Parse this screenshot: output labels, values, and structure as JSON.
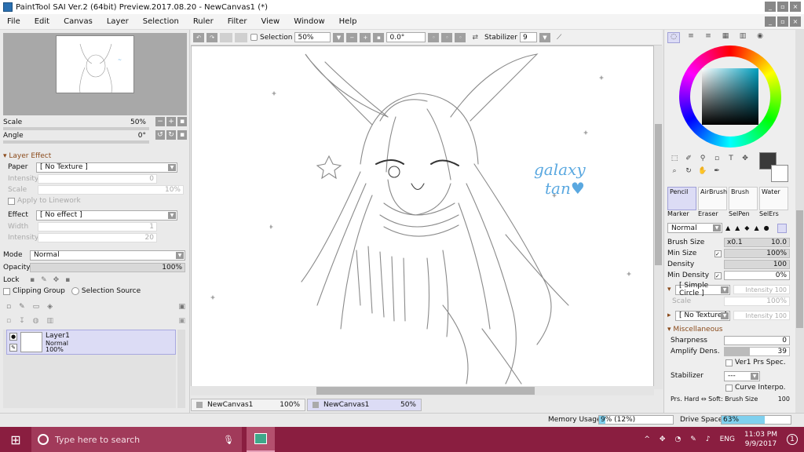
{
  "window": {
    "title": "PaintTool SAI Ver.2 (64bit) Preview.2017.08.20 - NewCanvas1 (*)"
  },
  "menu": [
    "File",
    "Edit",
    "Canvas",
    "Layer",
    "Selection",
    "Ruler",
    "Filter",
    "View",
    "Window",
    "Help"
  ],
  "navigator": {
    "scale_label": "Scale",
    "scale_value": "50%",
    "angle_label": "Angle",
    "angle_value": "0°"
  },
  "layer_effect": {
    "header": "Layer Effect",
    "paper_label": "Paper",
    "paper_value": "[ No Texture ]",
    "intensity_label": "Intensity",
    "intensity_value": "0",
    "scale_label": "Scale",
    "scale_value": "10%",
    "apply_linework": "Apply to Linework",
    "effect_label": "Effect",
    "effect_value": "[ No effect ]",
    "width_label": "Width",
    "width_value": "1",
    "effect_intensity_label": "Intensity",
    "effect_intensity_value": "20"
  },
  "layer_props": {
    "mode_label": "Mode",
    "mode_value": "Normal",
    "opacity_label": "Opacity",
    "opacity_value": "100%",
    "lock_label": "Lock",
    "clipping": "Clipping Group",
    "selection_source": "Selection Source"
  },
  "layer": {
    "name": "Layer1",
    "mode": "Normal",
    "opacity": "100%"
  },
  "toolbar": {
    "selection": "Selection",
    "zoom": "50%",
    "angle": "0.0°",
    "stabilizer_label": "Stabilizer",
    "stabilizer_value": "9"
  },
  "canvas": {
    "sketch_text_line1": "galaxy",
    "sketch_text_line2": "tan♥",
    "sketch_ink": "#5aa8e0"
  },
  "doc_tabs": [
    {
      "name": "NewCanvas1",
      "zoom": "100%"
    },
    {
      "name": "NewCanvas1",
      "zoom": "50%"
    }
  ],
  "color": {
    "current": "#3a3a3a"
  },
  "brushes": [
    "Pencil",
    "AirBrush",
    "Brush",
    "Water"
  ],
  "brushes_row2": [
    "Marker",
    "Eraser",
    "SelPen",
    "SelErs"
  ],
  "brush_settings": {
    "blend": "Normal",
    "brush_size_label": "Brush Size",
    "brush_size_mult": "x0.1",
    "brush_size_value": "10.0",
    "min_size_label": "Min Size",
    "min_size_value": "100%",
    "density_label": "Density",
    "density_value": "100",
    "min_density_label": "Min Density",
    "min_density_value": "0%",
    "shape": "[ Simple Circle ]",
    "shape_intensity": "Intensity 100",
    "shape_scale_label": "Scale",
    "shape_scale_value": "100%",
    "texture": "[ No Texture ]",
    "texture_intensity": "Intensity 100",
    "misc_header": "Miscellaneous",
    "sharpness_label": "Sharpness",
    "sharpness_value": "0",
    "amplify_label": "Amplify Dens.",
    "amplify_value": "39",
    "ver1": "Ver1 Prs Spec.",
    "stabilizer_label": "Stabilizer",
    "stabilizer_value": "---",
    "curve": "Curve Interpo.",
    "prs_label": "Prs. Hard ⇔ Soft: Brush Size",
    "prs_value": "100"
  },
  "status": {
    "memory_label": "Memory Usage",
    "memory_value": "9% (12%)",
    "memory_pct": 9,
    "drive_label": "Drive Space",
    "drive_value": "63%",
    "drive_pct": 63
  },
  "taskbar": {
    "search_placeholder": "Type here to search",
    "lang": "ENG",
    "time": "11:03 PM",
    "date": "9/9/2017",
    "notif_count": "1"
  }
}
